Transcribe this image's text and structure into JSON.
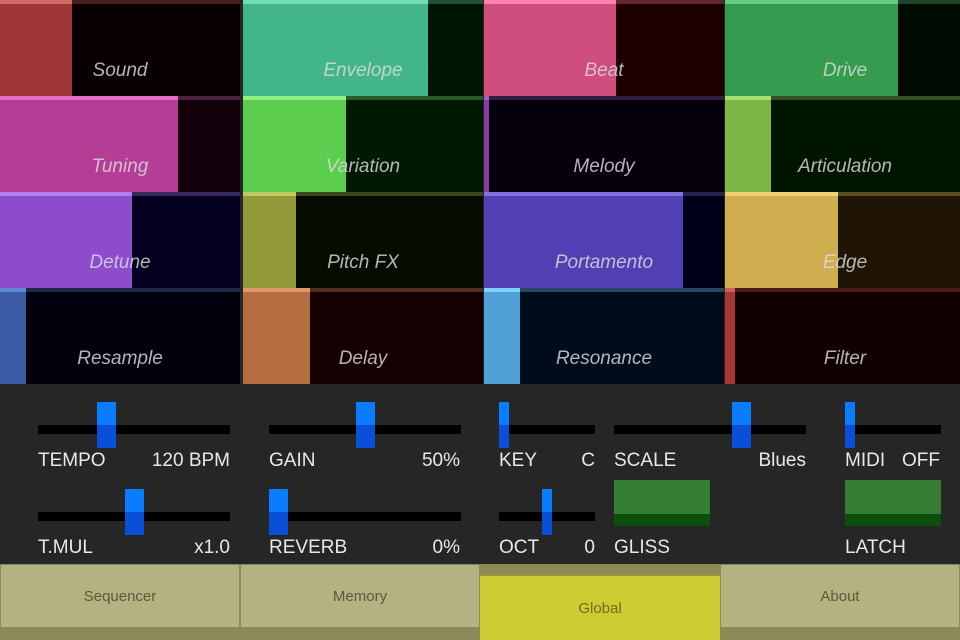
{
  "pads": [
    {
      "label": "Sound",
      "fill": 0.3,
      "color": "#9f3636",
      "bg": "#080002",
      "edge": "#d06a66"
    },
    {
      "label": "Envelope",
      "fill": 0.77,
      "color": "#43b58a",
      "bg": "#001404",
      "edge": "#70e0b0"
    },
    {
      "label": "Beat",
      "fill": 0.55,
      "color": "#cf4e7e",
      "bg": "#1e0002",
      "edge": "#ff80a8"
    },
    {
      "label": "Drive",
      "fill": 0.72,
      "color": "#359b4f",
      "bg": "#000c02",
      "edge": "#66cc80"
    },
    {
      "label": "Tuning",
      "fill": 0.74,
      "color": "#b43e96",
      "bg": "#12000a",
      "edge": "#e070c8"
    },
    {
      "label": "Variation",
      "fill": 0.43,
      "color": "#5ccd4e",
      "bg": "#001a02",
      "edge": "#90f080"
    },
    {
      "label": "Melody",
      "fill": 0.02,
      "color": "#8a3aa8",
      "bg": "#06000e",
      "edge": "#a060c0"
    },
    {
      "label": "Articulation",
      "fill": 0.19,
      "color": "#7db544",
      "bg": "#001500",
      "edge": "#a8e070"
    },
    {
      "label": "Detune",
      "fill": 0.55,
      "color": "#8c4ccc",
      "bg": "#02001e",
      "edge": "#b080f0"
    },
    {
      "label": "Pitch FX",
      "fill": 0.22,
      "color": "#929938",
      "bg": "#060c00",
      "edge": "#c0c860"
    },
    {
      "label": "Portamento",
      "fill": 0.83,
      "color": "#5040b4",
      "bg": "#000018",
      "edge": "#8070e0"
    },
    {
      "label": "Edge",
      "fill": 0.47,
      "color": "#cfae50",
      "bg": "#201404",
      "edge": "#f0d070"
    },
    {
      "label": "Resample",
      "fill": 0.11,
      "color": "#3a5aa2",
      "bg": "#02020e",
      "edge": "#6088d0"
    },
    {
      "label": "Delay",
      "fill": 0.28,
      "color": "#b46d40",
      "bg": "#140000",
      "edge": "#e09868"
    },
    {
      "label": "Resonance",
      "fill": 0.15,
      "color": "#50a2d6",
      "bg": "#000c1c",
      "edge": "#80d0ff"
    },
    {
      "label": "Filter",
      "fill": 0.04,
      "color": "#a83434",
      "bg": "#100000",
      "edge": "#d06060"
    }
  ],
  "controls": {
    "tempo": {
      "label": "TEMPO",
      "value": "120 BPM",
      "level": 0.34
    },
    "tmul": {
      "label": "T.MUL",
      "value": "x1.0",
      "level": 0.5
    },
    "gain": {
      "label": "GAIN",
      "value": "50%",
      "level": 0.5
    },
    "reverb": {
      "label": "REVERB",
      "value": "0%",
      "level": 0.0
    },
    "key": {
      "label": "KEY",
      "value": "C",
      "level": 0.0
    },
    "oct": {
      "label": "OCT",
      "value": "0",
      "level": 0.5
    },
    "scale": {
      "label": "SCALE",
      "value": "Blues",
      "level": 0.68
    },
    "midi": {
      "label": "MIDI",
      "value": "OFF",
      "level": 0.0
    },
    "gliss": {
      "label": "GLISS"
    },
    "latch": {
      "label": "LATCH"
    }
  },
  "tabs": [
    {
      "label": "Sequencer",
      "active": false
    },
    {
      "label": "Memory",
      "active": false
    },
    {
      "label": "Global",
      "active": true
    },
    {
      "label": "About",
      "active": false
    }
  ]
}
